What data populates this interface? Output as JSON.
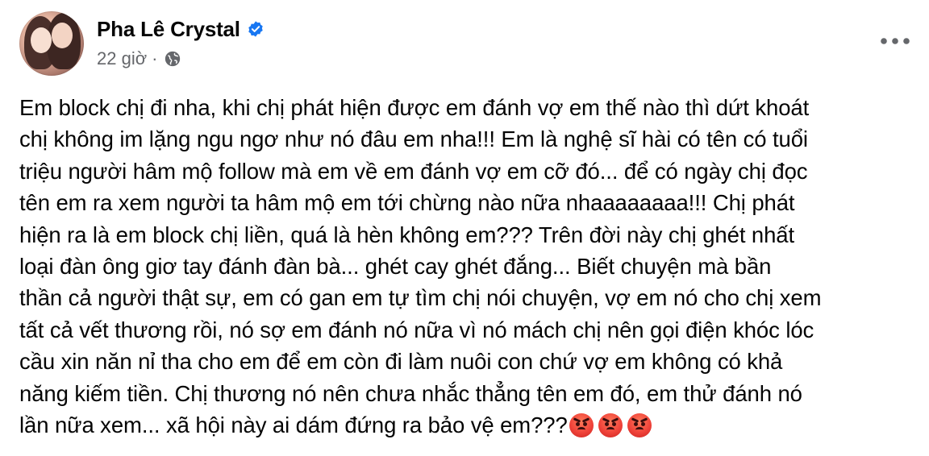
{
  "post": {
    "author": "Pha Lê Crystal",
    "time": "22 giờ",
    "separator": "·",
    "privacy_icon": "globe-icon",
    "verified_icon": "verified-badge-icon",
    "more_icon": "more-options-icon",
    "lines": [
      "Em block chị đi nha, khi chị phát hiện được em đánh vợ em thế nào thì dứt khoát",
      "chị không im lặng ngu ngơ như nó đâu em nha!!! Em là nghệ sĩ hài có tên có tuổi",
      "triệu người hâm mộ follow mà em về em đánh vợ em cỡ đó... để có ngày chị đọc",
      "tên em ra xem người ta hâm mộ em tới chừng nào nữa nhaaaaaaaa!!! Chị phát",
      "hiện ra là em block chị liền, quá là hèn không em??? Trên đời này chị ghét nhất",
      "loại đàn ông giơ tay đánh đàn bà... ghét cay ghét đắng... Biết chuyện mà bần",
      "thần cả người thật sự, em có gan em tự tìm chị nói chuyện, vợ em nó cho chị xem",
      "tất cả vết thương rồi, nó sợ em đánh nó nữa vì nó mách chị nên gọi điện khóc lóc",
      "cầu xin năn nỉ tha cho em để em còn đi làm nuôi con chứ vợ em không có khả",
      "năng kiếm tiền. Chị thương nó nên chưa nhắc thẳng tên em đó, em thử đánh nó",
      "lần nữa xem... xã hội này ai dám đứng ra bảo vệ em???"
    ],
    "emoji_icon": "angry-face-emoji",
    "emoji_count": 3
  },
  "colors": {
    "text": "#050505",
    "secondary": "#65676b",
    "verified": "#1877f2",
    "emoji": "#f0433a"
  }
}
